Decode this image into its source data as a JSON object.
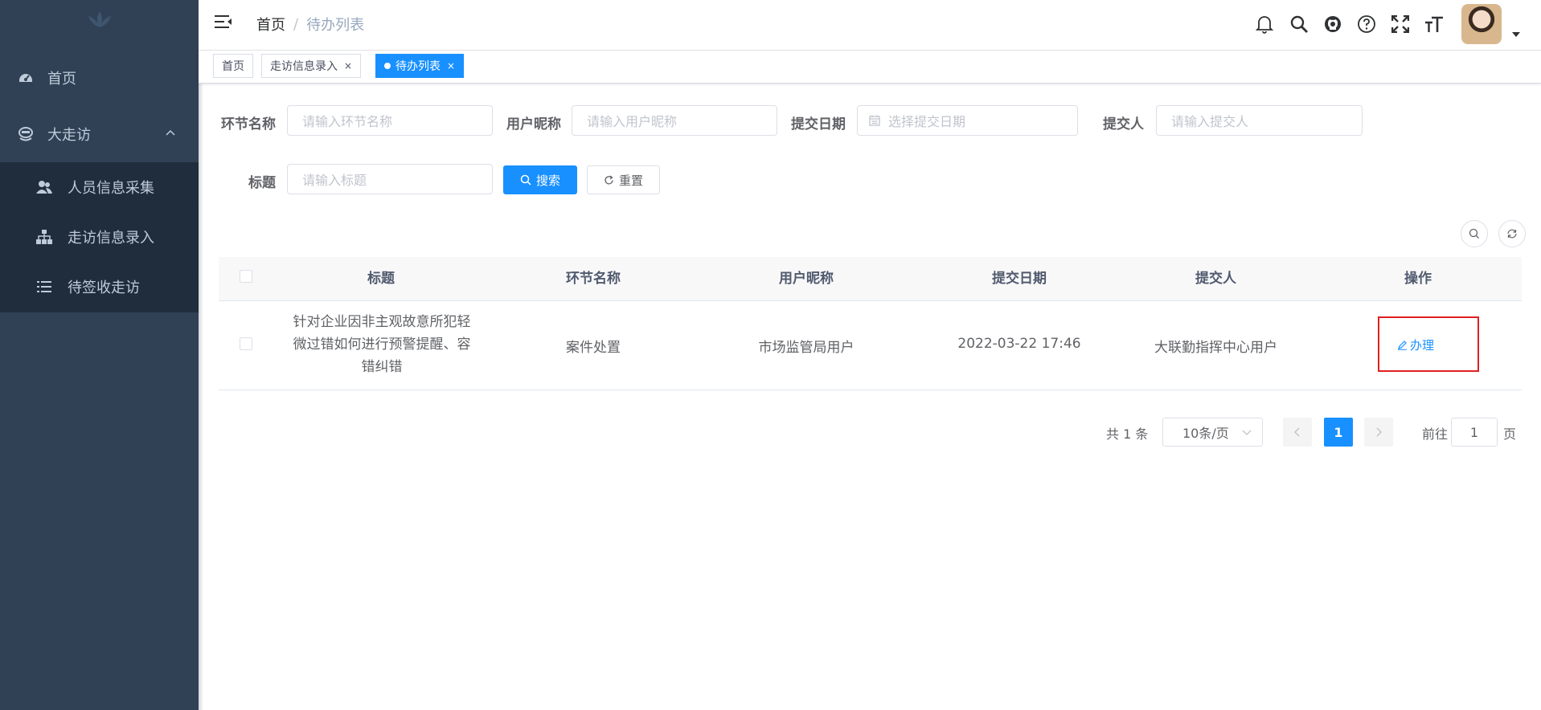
{
  "sidebar": {
    "menu": [
      {
        "label": "首页",
        "icon": "dashboard-icon"
      },
      {
        "label": "大走访",
        "icon": "visit-icon"
      }
    ],
    "submenu": [
      {
        "label": "人员信息采集",
        "icon": "peoples-icon"
      },
      {
        "label": "走访信息录入",
        "icon": "tree-icon"
      },
      {
        "label": "待签收走访",
        "icon": "list-icon"
      }
    ]
  },
  "navbar": {
    "breadcrumb": {
      "home": "首页",
      "separator": "/",
      "current": "待办列表"
    }
  },
  "tags": [
    {
      "label": "首页",
      "active": false
    },
    {
      "label": "走访信息录入",
      "close": "×",
      "active": false
    },
    {
      "label": "待办列表",
      "close": "×",
      "active": true
    }
  ],
  "search": {
    "stage_label": "环节名称",
    "stage_placeholder": "请输入环节名称",
    "nickname_label": "用户昵称",
    "nickname_placeholder": "请输入用户昵称",
    "date_label": "提交日期",
    "date_placeholder": "选择提交日期",
    "submitter_label": "提交人",
    "submitter_placeholder": "请输入提交人",
    "title_label": "标题",
    "title_placeholder": "请输入标题",
    "search_button": "搜索",
    "reset_button": "重置"
  },
  "table": {
    "columns": [
      "标题",
      "环节名称",
      "用户昵称",
      "提交日期",
      "提交人",
      "操作"
    ],
    "rows": [
      {
        "title": "针对企业因非主观故意所犯轻微过错如何进行预警提醒、容错纠错",
        "stage": "案件处置",
        "nickname": "市场监管局用户",
        "date": "2022-03-22 17:46",
        "submitter": "大联勤指挥中心用户",
        "action": "办理"
      }
    ]
  },
  "pagination": {
    "total": "共 1 条",
    "page_size": "10条/页",
    "current": "1",
    "goto_prefix": "前往",
    "goto_value": "1",
    "goto_suffix": "页"
  },
  "colors": {
    "sidebar": "#304156",
    "submenu": "#1f2d3d",
    "primary": "#1890ff",
    "highlight": "#e02020"
  }
}
